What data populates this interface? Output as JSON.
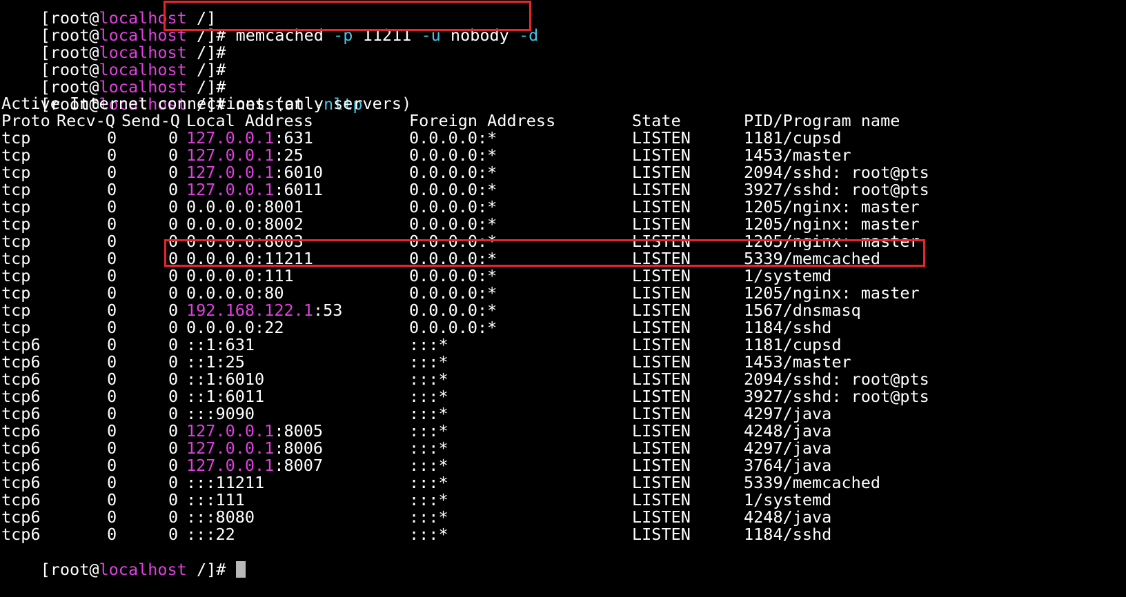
{
  "terminal": {
    "prompt": {
      "open": "[",
      "user": "root",
      "at": "@",
      "host": "localhost",
      "path": " /]",
      "hash": "#"
    },
    "commands": {
      "memcached": {
        "program": "memcached",
        "flag_p": "-p",
        "port": "11211",
        "flag_u": "-u",
        "user": "nobody",
        "flag_d": "-d"
      },
      "netstat": {
        "program": "netstat",
        "flags": "-nltp"
      }
    },
    "output_title": "Active Internet connections (only servers)",
    "headers": {
      "proto": "Proto",
      "recvq": "Recv-Q",
      "sendq": "Send-Q",
      "local": "Local Address",
      "foreign": "Foreign Address",
      "state": "State",
      "pid": "PID/Program name"
    },
    "rows": [
      {
        "proto": "tcp",
        "recvq": "0",
        "sendq": "0",
        "local_ip": "127.0.0.1",
        "local_port": ":631",
        "foreign": "0.0.0.0:*",
        "state": "LISTEN",
        "pid": "1181/cupsd"
      },
      {
        "proto": "tcp",
        "recvq": "0",
        "sendq": "0",
        "local_ip": "127.0.0.1",
        "local_port": ":25",
        "foreign": "0.0.0.0:*",
        "state": "LISTEN",
        "pid": "1453/master"
      },
      {
        "proto": "tcp",
        "recvq": "0",
        "sendq": "0",
        "local_ip": "127.0.0.1",
        "local_port": ":6010",
        "foreign": "0.0.0.0:*",
        "state": "LISTEN",
        "pid": "2094/sshd: root@pts"
      },
      {
        "proto": "tcp",
        "recvq": "0",
        "sendq": "0",
        "local_ip": "127.0.0.1",
        "local_port": ":6011",
        "foreign": "0.0.0.0:*",
        "state": "LISTEN",
        "pid": "3927/sshd: root@pts"
      },
      {
        "proto": "tcp",
        "recvq": "0",
        "sendq": "0",
        "local_ip": "",
        "local_port": "0.0.0.0:8001",
        "foreign": "0.0.0.0:*",
        "state": "LISTEN",
        "pid": "1205/nginx: master"
      },
      {
        "proto": "tcp",
        "recvq": "0",
        "sendq": "0",
        "local_ip": "",
        "local_port": "0.0.0.0:8002",
        "foreign": "0.0.0.0:*",
        "state": "LISTEN",
        "pid": "1205/nginx: master"
      },
      {
        "proto": "tcp",
        "recvq": "0",
        "sendq": "0",
        "local_ip": "",
        "local_port": "0.0.0.0:8003",
        "foreign": "0.0.0.0:*",
        "state": "LISTEN",
        "pid": "1205/nginx: master"
      },
      {
        "proto": "tcp",
        "recvq": "0",
        "sendq": "0",
        "local_ip": "",
        "local_port": "0.0.0.0:11211",
        "foreign": "0.0.0.0:*",
        "state": "LISTEN",
        "pid": "5339/memcached"
      },
      {
        "proto": "tcp",
        "recvq": "0",
        "sendq": "0",
        "local_ip": "",
        "local_port": "0.0.0.0:111",
        "foreign": "0.0.0.0:*",
        "state": "LISTEN",
        "pid": "1/systemd"
      },
      {
        "proto": "tcp",
        "recvq": "0",
        "sendq": "0",
        "local_ip": "",
        "local_port": "0.0.0.0:80",
        "foreign": "0.0.0.0:*",
        "state": "LISTEN",
        "pid": "1205/nginx: master"
      },
      {
        "proto": "tcp",
        "recvq": "0",
        "sendq": "0",
        "local_ip": "192.168.122.1",
        "local_port": ":53",
        "foreign": "0.0.0.0:*",
        "state": "LISTEN",
        "pid": "1567/dnsmasq"
      },
      {
        "proto": "tcp",
        "recvq": "0",
        "sendq": "0",
        "local_ip": "",
        "local_port": "0.0.0.0:22",
        "foreign": "0.0.0.0:*",
        "state": "LISTEN",
        "pid": "1184/sshd"
      },
      {
        "proto": "tcp6",
        "recvq": "0",
        "sendq": "0",
        "local_ip": "",
        "local_port": "::1:631",
        "foreign": ":::*",
        "state": "LISTEN",
        "pid": "1181/cupsd"
      },
      {
        "proto": "tcp6",
        "recvq": "0",
        "sendq": "0",
        "local_ip": "",
        "local_port": "::1:25",
        "foreign": ":::*",
        "state": "LISTEN",
        "pid": "1453/master"
      },
      {
        "proto": "tcp6",
        "recvq": "0",
        "sendq": "0",
        "local_ip": "",
        "local_port": "::1:6010",
        "foreign": ":::*",
        "state": "LISTEN",
        "pid": "2094/sshd: root@pts"
      },
      {
        "proto": "tcp6",
        "recvq": "0",
        "sendq": "0",
        "local_ip": "",
        "local_port": "::1:6011",
        "foreign": ":::*",
        "state": "LISTEN",
        "pid": "3927/sshd: root@pts"
      },
      {
        "proto": "tcp6",
        "recvq": "0",
        "sendq": "0",
        "local_ip": "",
        "local_port": ":::9090",
        "foreign": ":::*",
        "state": "LISTEN",
        "pid": "4297/java"
      },
      {
        "proto": "tcp6",
        "recvq": "0",
        "sendq": "0",
        "local_ip": "127.0.0.1",
        "local_port": ":8005",
        "foreign": ":::*",
        "state": "LISTEN",
        "pid": "4248/java"
      },
      {
        "proto": "tcp6",
        "recvq": "0",
        "sendq": "0",
        "local_ip": "127.0.0.1",
        "local_port": ":8006",
        "foreign": ":::*",
        "state": "LISTEN",
        "pid": "4297/java"
      },
      {
        "proto": "tcp6",
        "recvq": "0",
        "sendq": "0",
        "local_ip": "127.0.0.1",
        "local_port": ":8007",
        "foreign": ":::*",
        "state": "LISTEN",
        "pid": "3764/java"
      },
      {
        "proto": "tcp6",
        "recvq": "0",
        "sendq": "0",
        "local_ip": "",
        "local_port": ":::11211",
        "foreign": ":::*",
        "state": "LISTEN",
        "pid": "5339/memcached"
      },
      {
        "proto": "tcp6",
        "recvq": "0",
        "sendq": "0",
        "local_ip": "",
        "local_port": ":::111",
        "foreign": ":::*",
        "state": "LISTEN",
        "pid": "1/systemd"
      },
      {
        "proto": "tcp6",
        "recvq": "0",
        "sendq": "0",
        "local_ip": "",
        "local_port": ":::8080",
        "foreign": ":::*",
        "state": "LISTEN",
        "pid": "4248/java"
      },
      {
        "proto": "tcp6",
        "recvq": "0",
        "sendq": "0",
        "local_ip": "",
        "local_port": ":::22",
        "foreign": ":::*",
        "state": "LISTEN",
        "pid": "1184/sshd"
      }
    ]
  },
  "colors": {
    "background": "#000000",
    "text": "#ffffff",
    "host": "#e040e0",
    "flag": "#3fc6ea",
    "annotation_box": "#e8262a",
    "cursor": "#b8b8b8"
  }
}
